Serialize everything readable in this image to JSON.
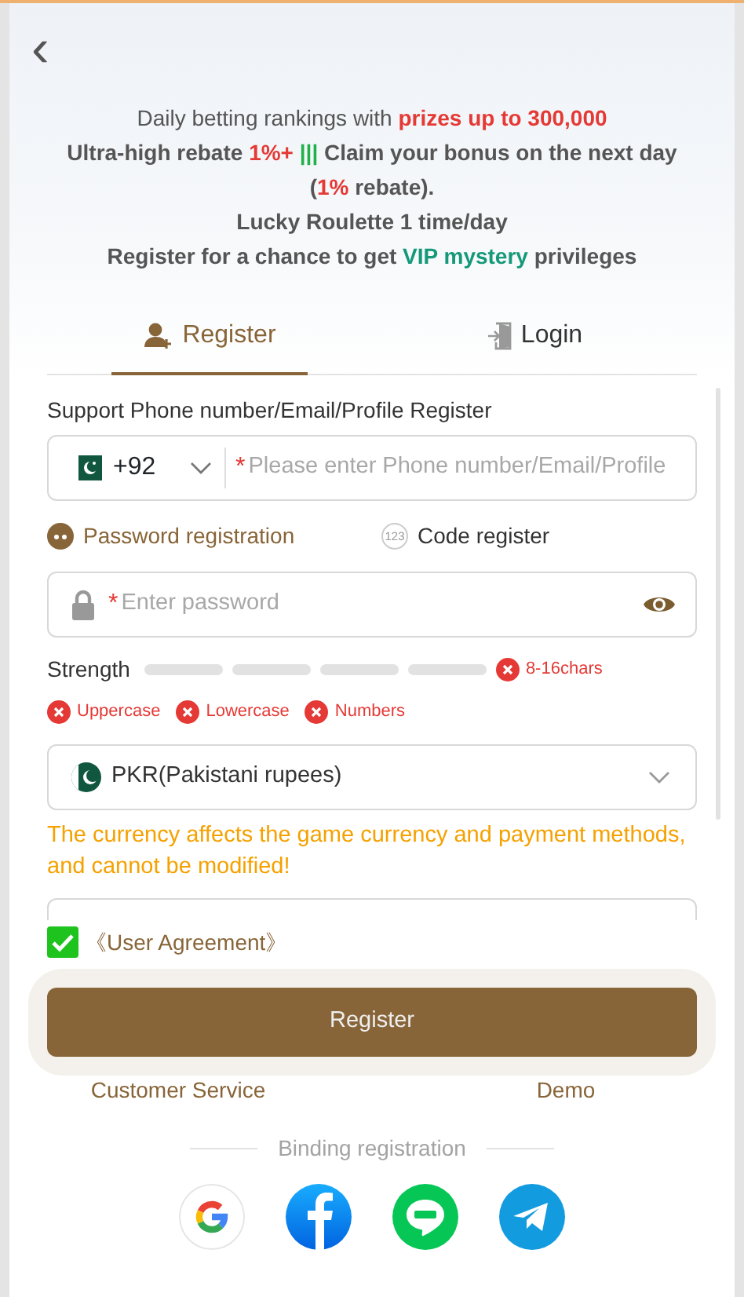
{
  "back": {
    "icon": "‹"
  },
  "promo": [
    {
      "segments": [
        {
          "text": "Daily betting rankings with ",
          "bold": false,
          "color": "#555555"
        },
        {
          "text": "prizes up to 300,000",
          "bold": true,
          "color": "#e53935"
        }
      ]
    },
    {
      "segments": [
        {
          "text": "Ultra-high rebate ",
          "bold": true,
          "color": "#555555"
        },
        {
          "text": "1%+",
          "bold": true,
          "color": "#e53935"
        },
        {
          "text": " |||",
          "bold": true,
          "color": "#21b14b"
        },
        {
          "text": " Claim your bonus on the next day (",
          "bold": true,
          "color": "#555555"
        },
        {
          "text": "1%",
          "bold": true,
          "color": "#e53935"
        },
        {
          "text": " rebate).",
          "bold": true,
          "color": "#555555"
        }
      ]
    },
    {
      "segments": [
        {
          "text": "Lucky Roulette 1 time/day",
          "bold": true,
          "color": "#555555"
        }
      ]
    },
    {
      "segments": [
        {
          "text": "Register for a chance to get ",
          "bold": true,
          "color": "#555555"
        },
        {
          "text": "VIP mystery",
          "bold": true,
          "color": "#15997a"
        },
        {
          "text": " privileges",
          "bold": true,
          "color": "#555555"
        }
      ]
    }
  ],
  "tabs": [
    {
      "label": "Register",
      "kind": "register",
      "selected": true
    },
    {
      "label": "Login",
      "kind": "login",
      "selected": false
    }
  ],
  "account": {
    "label": "Support Phone number/Email/Profile Register",
    "country_code": "+92",
    "required_mark": "*",
    "placeholder": "Please enter Phone number/Email/Profile"
  },
  "methods": [
    {
      "label": "Password registration",
      "kind": "password",
      "selected": true
    },
    {
      "label": "Code register",
      "kind": "code",
      "icon": "123",
      "selected": false
    }
  ],
  "password": {
    "required_mark": "*",
    "placeholder": "Enter password"
  },
  "strength": {
    "label": "Strength"
  },
  "rules": [
    {
      "label": "8-16chars",
      "met": false
    },
    {
      "label": "Uppercase",
      "met": false
    },
    {
      "label": "Lowercase",
      "met": false
    },
    {
      "label": "Numbers",
      "met": false
    }
  ],
  "currency": {
    "value": "PKR(Pakistani rupees)",
    "note": "The currency affects the game currency and payment methods, and cannot be modified!"
  },
  "partial_field": {
    "kind": "text"
  },
  "agreement": {
    "label": "《User Agreement》",
    "checked": true
  },
  "submit": {
    "label": "Register"
  },
  "links": [
    "Customer Service",
    "Demo"
  ],
  "binding": {
    "label": "Binding registration",
    "providers": [
      {
        "kind": "google"
      },
      {
        "kind": "facebook"
      },
      {
        "kind": "line"
      },
      {
        "kind": "telegram"
      }
    ]
  }
}
